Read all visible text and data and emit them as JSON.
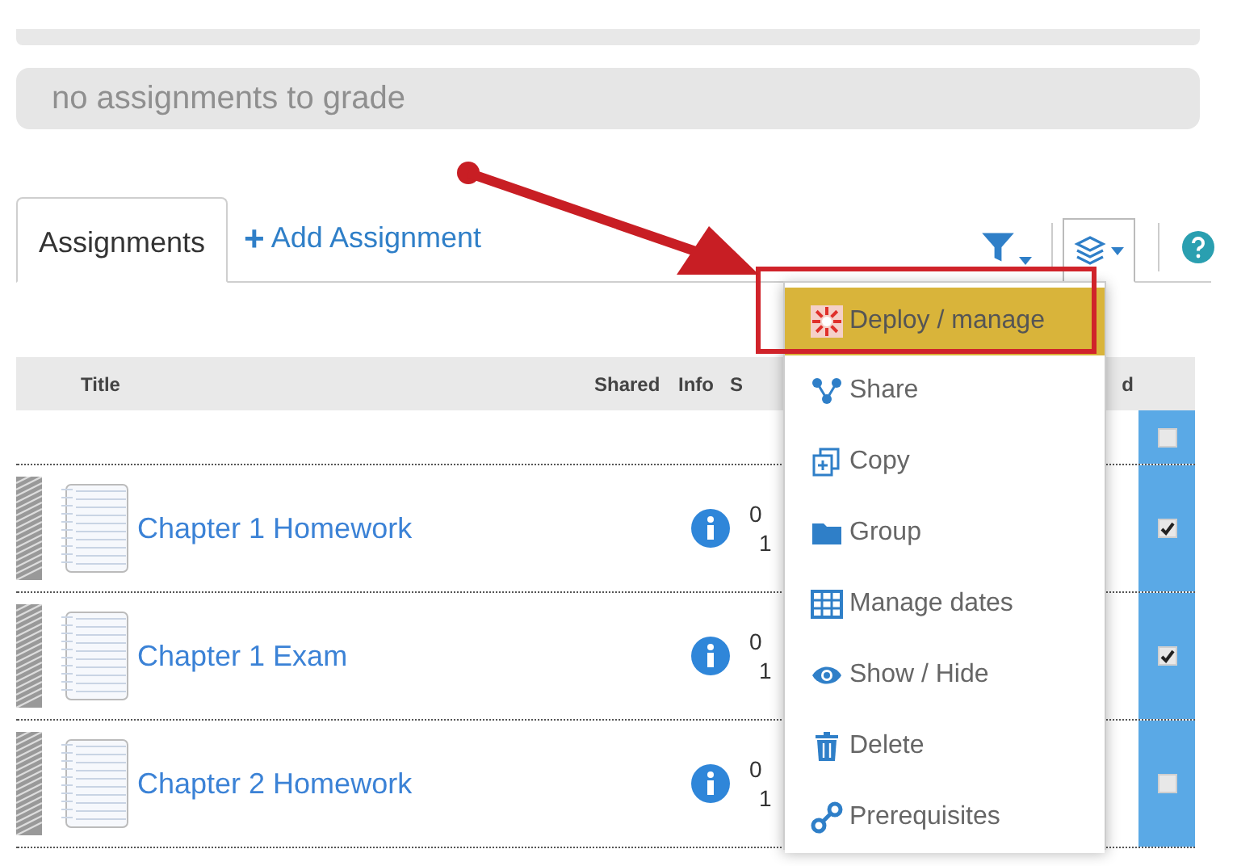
{
  "grade_field": {
    "placeholder": "no assignments to grade"
  },
  "tabs": [
    {
      "label": "Assignments",
      "selected": true
    }
  ],
  "add_button": {
    "label": "Add Assignment",
    "icon": "+"
  },
  "table": {
    "columns": [
      "Title",
      "Shared",
      "Info",
      "S",
      "d"
    ],
    "select_all": {
      "checked": false
    },
    "rows": [
      {
        "title": "Chapter 1 Homework",
        "column_4": [
          "0",
          "1"
        ],
        "checked": true
      },
      {
        "title": "Chapter 1 Exam",
        "column_4": [
          "0",
          "1"
        ],
        "checked": true
      },
      {
        "title": "Chapter 2 Homework",
        "column_4": [
          "0",
          "1"
        ],
        "checked": false
      }
    ]
  },
  "menu": {
    "items": [
      {
        "label": "Deploy / manage",
        "kind": "deploy",
        "selected": true
      },
      {
        "label": "Share",
        "kind": "share",
        "selected": false
      },
      {
        "label": "Copy",
        "kind": "copy",
        "selected": false
      },
      {
        "label": "Group",
        "kind": "group",
        "selected": false
      },
      {
        "label": "Manage dates",
        "kind": "dates",
        "selected": false
      },
      {
        "label": "Show / Hide",
        "kind": "visibility",
        "selected": false
      },
      {
        "label": "Delete",
        "kind": "delete",
        "selected": false
      },
      {
        "label": "Prerequisites",
        "kind": "prerequisites",
        "selected": false
      }
    ]
  }
}
